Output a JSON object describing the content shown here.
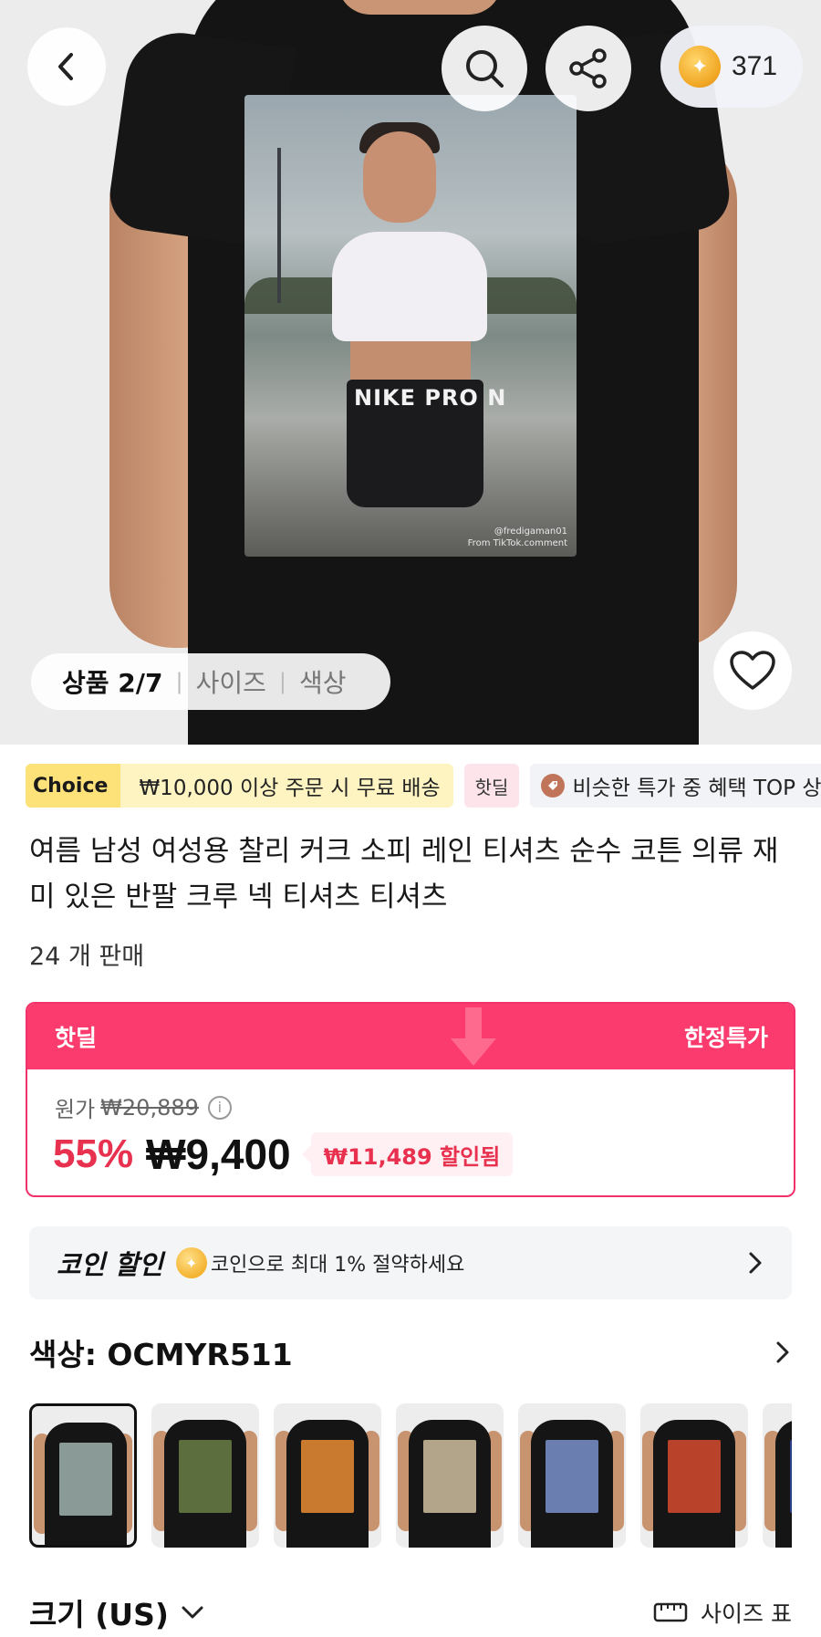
{
  "header": {
    "coin_count": "371"
  },
  "hero": {
    "print_text": "NIKE PRO N",
    "print_credit_1": "@fredigaman01",
    "print_credit_2": "From TikTok.comment",
    "gallery_tabs": {
      "active": "상품 2/7",
      "size": "사이즈",
      "color": "색상"
    }
  },
  "tags": {
    "choice": "Choice",
    "free_shipping": "₩10,000 이상 주문 시 무료 배송",
    "hot_deal": "핫딜",
    "similar": "비슷한 특가 중 혜택 TOP 상"
  },
  "product": {
    "title": "여름 남성 여성용 찰리 커크 소피 레인 티셔츠 순수 코튼 의류 재미 있은 반팔 크루 넥 티셔츠 티셔츠",
    "sold": "24 개 판매"
  },
  "price": {
    "banner_left": "핫딜",
    "banner_right": "한정특가",
    "original_label": "원가",
    "original_price": "₩20,889",
    "discount_pct": "55%",
    "current_price": "₩9,400",
    "saved": "₩11,489 할인됨"
  },
  "coin_discount": {
    "label": "코인 할인",
    "desc": "코인으로 최대 1% 절약하세요"
  },
  "color": {
    "label": "색상: OCMYR511",
    "swatch_art_colors": [
      "#8a9a96",
      "#5d6e3e",
      "#c97a2e",
      "#b3a58a",
      "#6a7fb0",
      "#b8432a",
      "#2a3d8a"
    ]
  },
  "size": {
    "label": "크기 (US)",
    "chart": "사이즈 표"
  },
  "colors": {
    "accent": "#fb3b6d",
    "price_red": "#e8304f",
    "choice_yellow": "#fde27a"
  }
}
